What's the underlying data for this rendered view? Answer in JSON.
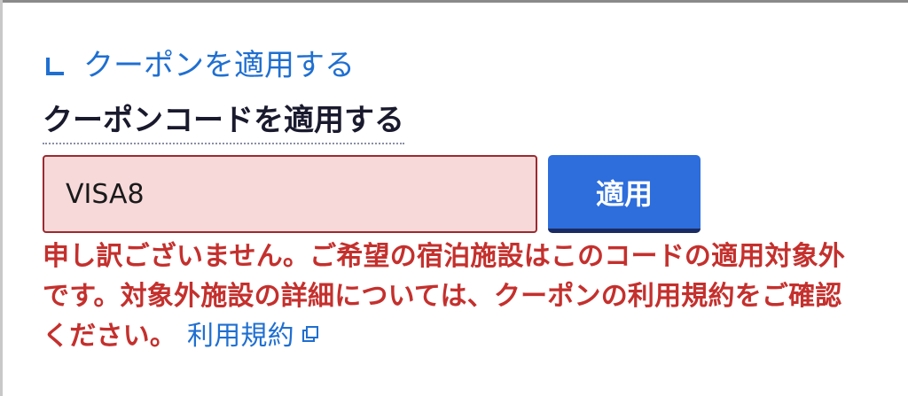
{
  "coupon_toggle": {
    "label": "クーポンを適用する",
    "icon": "return-arrow-icon",
    "color": "#1f6fd1"
  },
  "coupon_form": {
    "title": "クーポンコードを適用する",
    "input_value": "VISA8",
    "button_label": "適用",
    "button_color": "#2d6ddc",
    "input_error_bg": "#f7d9da",
    "input_error_border": "#9c2a2f"
  },
  "error": {
    "message": "申し訳ございません。ご希望の宿泊施設はこのコードの適用対象外です。対象外施設の詳細については、クーポンの利用規約をご確認ください。",
    "terms_link_label": "利用規約",
    "terms_link_icon": "external-link-icon",
    "color": "#c4302d"
  }
}
